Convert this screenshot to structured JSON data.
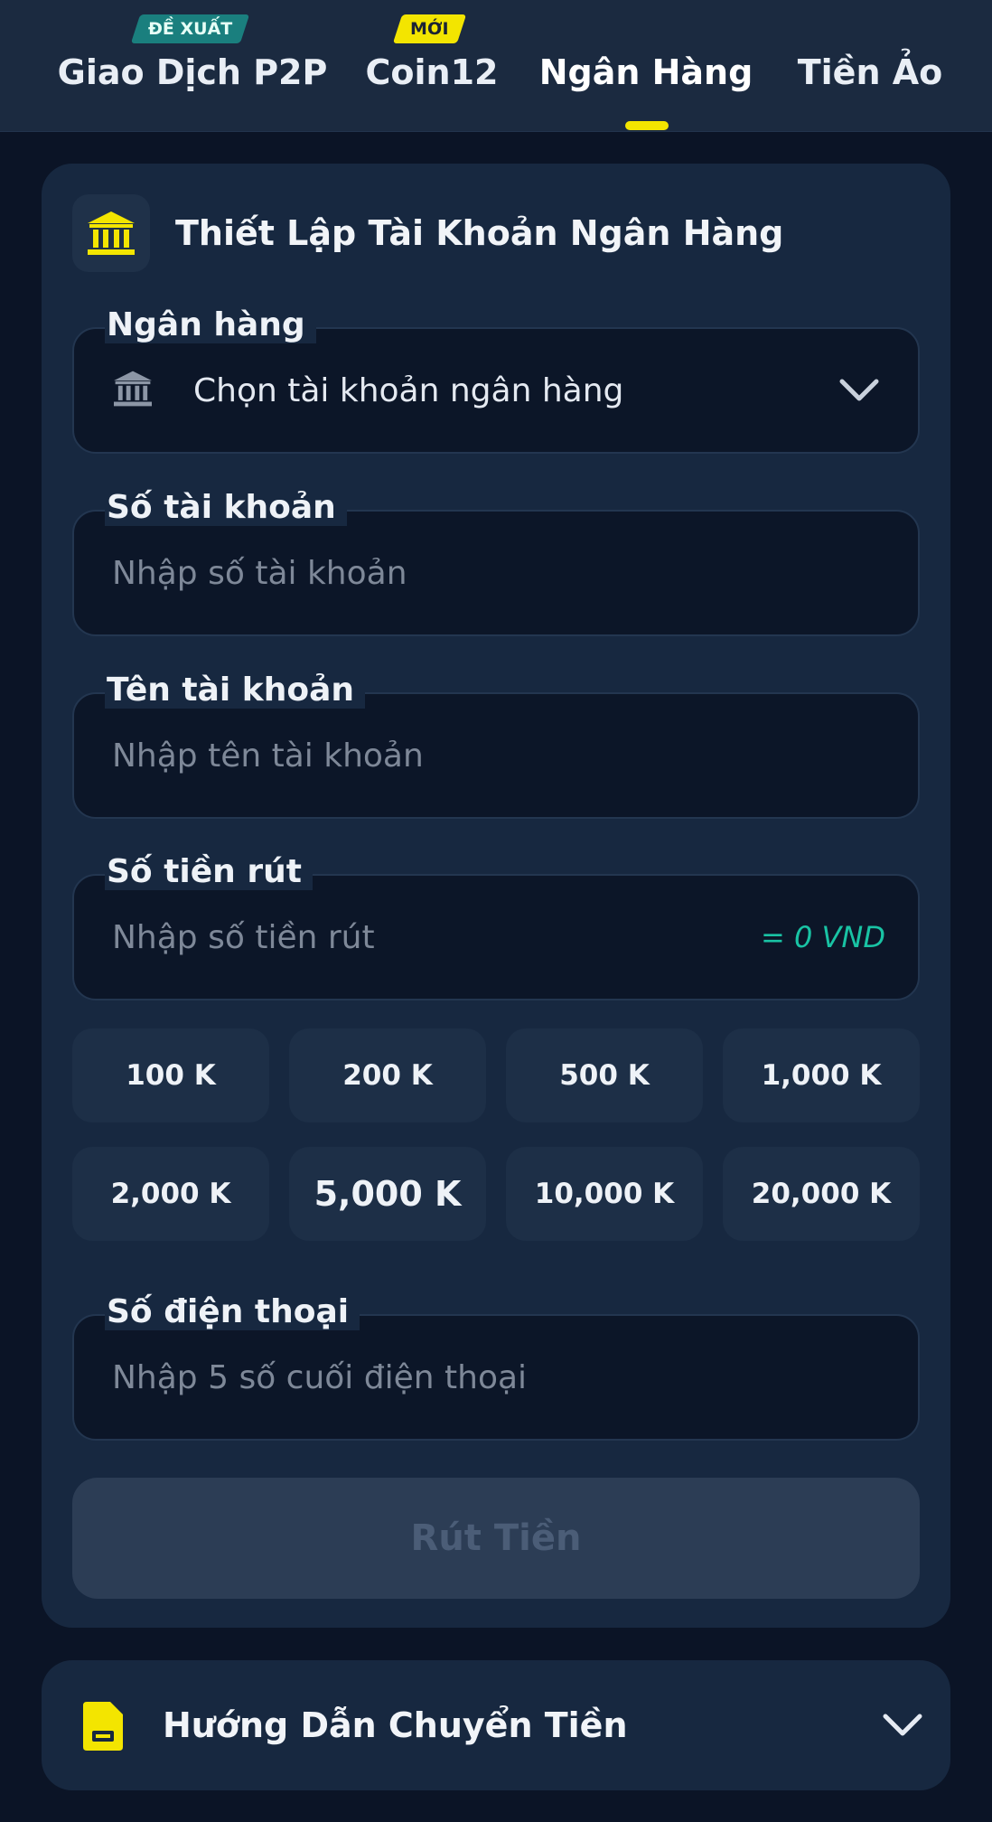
{
  "tabs": [
    {
      "label": "Giao Dịch P2P",
      "badge": "ĐỀ XUẤT"
    },
    {
      "label": "Coin12",
      "badge": "MỚI"
    },
    {
      "label": "Ngân Hàng",
      "badge": null
    },
    {
      "label": "Tiền Ảo",
      "badge": null
    }
  ],
  "active_tab": "Ngân Hàng",
  "icons": {
    "header": "bank-icon",
    "bank_field": "bank-icon",
    "dropdown": "chevron-down-icon",
    "guide": "sim-card-icon"
  },
  "colors": {
    "accent_yellow": "#f3e500",
    "badge_teal": "#1a7f7e",
    "suffix_teal": "#19c3a4",
    "background": "#0b1426",
    "card": "#172840"
  },
  "card": {
    "title": "Thiết Lập Tài Khoản Ngân Hàng",
    "bank": {
      "label": "Ngân hàng",
      "value": "Chọn tài khoản ngân hàng"
    },
    "account_number": {
      "label": "Số tài khoản",
      "placeholder": "Nhập số tài khoản"
    },
    "account_name": {
      "label": "Tên tài khoản",
      "placeholder": "Nhập tên tài khoản"
    },
    "amount": {
      "label": "Số tiền rút",
      "placeholder": "Nhập số tiền rút",
      "suffix": "= 0 VND"
    },
    "amount_chips": [
      "100 K",
      "200 K",
      "500 K",
      "1,000 K",
      "2,000 K",
      "5,000 K",
      "10,000 K",
      "20,000 K"
    ],
    "phone": {
      "label": "Số điện thoại",
      "placeholder": "Nhập 5 số cuối điện thoại"
    },
    "submit_label": "Rút Tiền"
  },
  "guide": {
    "title": "Hướng Dẫn Chuyển Tiền"
  }
}
